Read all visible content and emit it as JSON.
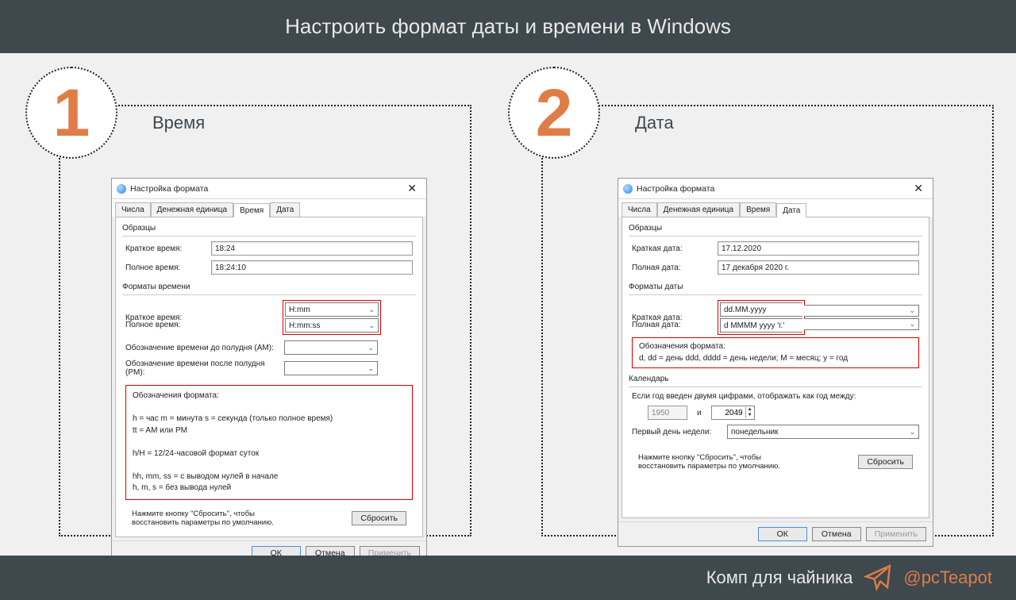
{
  "banner": {
    "title": "Настроить формат даты и времени в Windows"
  },
  "footer": {
    "text": "Комп для чайника",
    "handle": "@pcTeapot"
  },
  "step1": {
    "num": "1",
    "title": "Время",
    "dlg": {
      "title": "Настройка формата",
      "tabs": [
        "Числа",
        "Денежная единица",
        "Время",
        "Дата"
      ],
      "samples_title": "Образцы",
      "short_label": "Краткое время:",
      "short_value": "18:24",
      "long_label": "Полное время:",
      "long_value": "18:24:10",
      "formats_title": "Форматы времени",
      "fmt_short_label": "Краткое время:",
      "fmt_short": "H:mm",
      "fmt_long_label": "Полное время:",
      "fmt_long": "H:mm:ss",
      "am_label": "Обозначение времени до полудня (AM):",
      "pm_label": "Обозначение времени после полудня (PM):",
      "help_title": "Обозначения формата:",
      "help1": "h = час   m = минута   s = секунда (только полное время)",
      "help2": "tt = AM или PM",
      "help3": "h/H = 12/24-часовой формат суток",
      "help4": "hh, mm, ss = с выводом нулей в начале",
      "help5": "h, m, s = без вывода нулей",
      "reset_hint": "Нажмите кнопку \"Сбросить\", чтобы восстановить параметры по умолчанию.",
      "reset": "Сбросить",
      "ok": "ОК",
      "cancel": "Отмена",
      "apply": "Применить"
    }
  },
  "step2": {
    "num": "2",
    "title": "Дата",
    "dlg": {
      "title": "Настройка формата",
      "tabs": [
        "Числа",
        "Денежная единица",
        "Время",
        "Дата"
      ],
      "samples_title": "Образцы",
      "short_label": "Краткая дата:",
      "short_value": "17.12.2020",
      "long_label": "Полная дата:",
      "long_value": "17 декабря 2020 г.",
      "formats_title": "Форматы даты",
      "fmt_short_label": "Краткая дата:",
      "fmt_short": "dd.MM.yyyy",
      "fmt_long_label": "Полная дата:",
      "fmt_long": "d MMMM yyyy 'г.'",
      "help_title": "Обозначения формата:",
      "help1": "d, dd = день  ddd, dddd = день недели; M = месяц; y = год",
      "cal_title": "Календарь",
      "cal_hint": "Если год введен двумя цифрами, отображать как год между:",
      "year_from": "1950",
      "and": "и",
      "year_to": "2049",
      "firstday_label": "Первый день недели:",
      "firstday": "понедельник",
      "reset_hint": "Нажмите кнопку \"Сбросить\", чтобы восстановить параметры по умолчанию.",
      "reset": "Сбросить",
      "ok": "ОК",
      "cancel": "Отмена",
      "apply": "Применить"
    }
  }
}
